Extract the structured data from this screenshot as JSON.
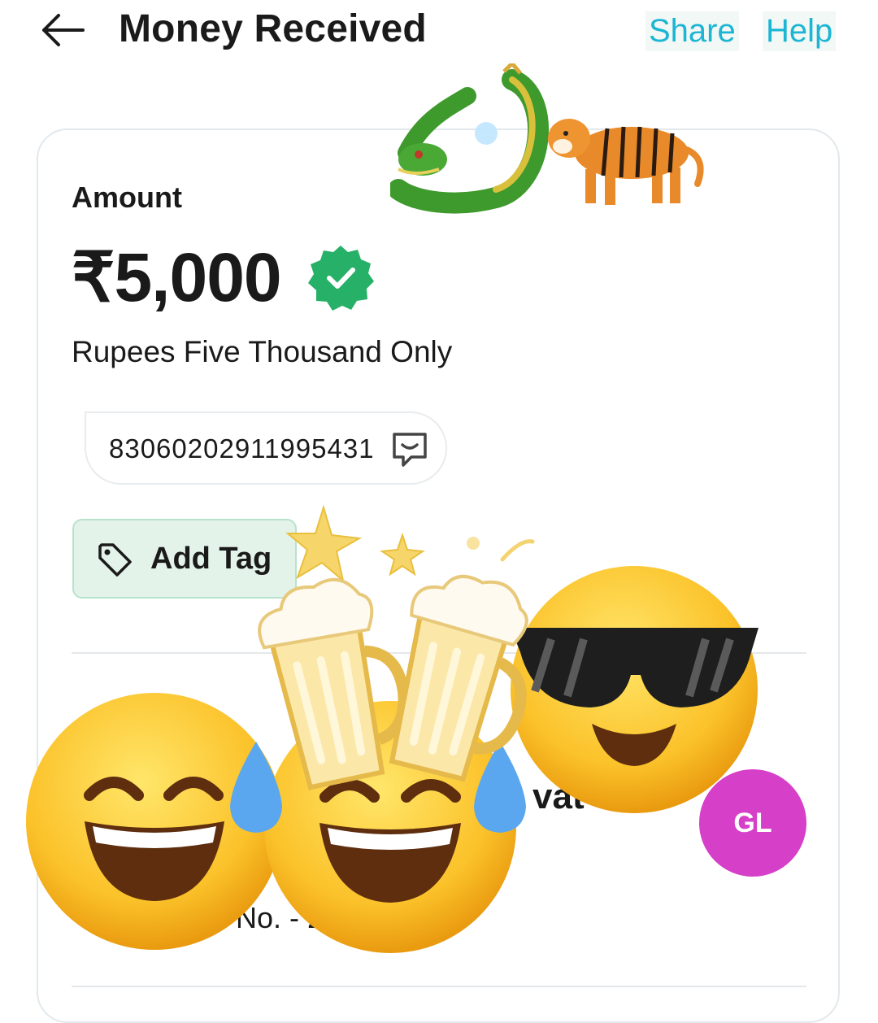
{
  "header": {
    "title": "Money Received",
    "share_label": "Share",
    "help_label": "Help"
  },
  "payment": {
    "amount_label": "Amount",
    "amount": "₹5,000",
    "amount_words": "Rupees Five Thousand Only",
    "reference_id": "83060202911995431",
    "add_tag_label": "Add Tag"
  },
  "details": {
    "partial_name_text": "vat",
    "partial_ref_text": "No. - 2",
    "avatar_initials": "GL"
  },
  "colors": {
    "accent": "#1cb5d4",
    "verified": "#27b067",
    "tag_bg": "#e3f3ea",
    "avatar": "#d63fc8"
  },
  "icons": [
    "back-arrow-icon",
    "verified-badge-icon",
    "chat-bubble-icon",
    "tag-icon"
  ],
  "stickers": [
    "dragon-sticker",
    "tiger-sticker",
    "beer-mugs-sticker",
    "sunglasses-face-sticker",
    "joy-face-sticker",
    "grin-face-sticker",
    "stars-sticker"
  ]
}
